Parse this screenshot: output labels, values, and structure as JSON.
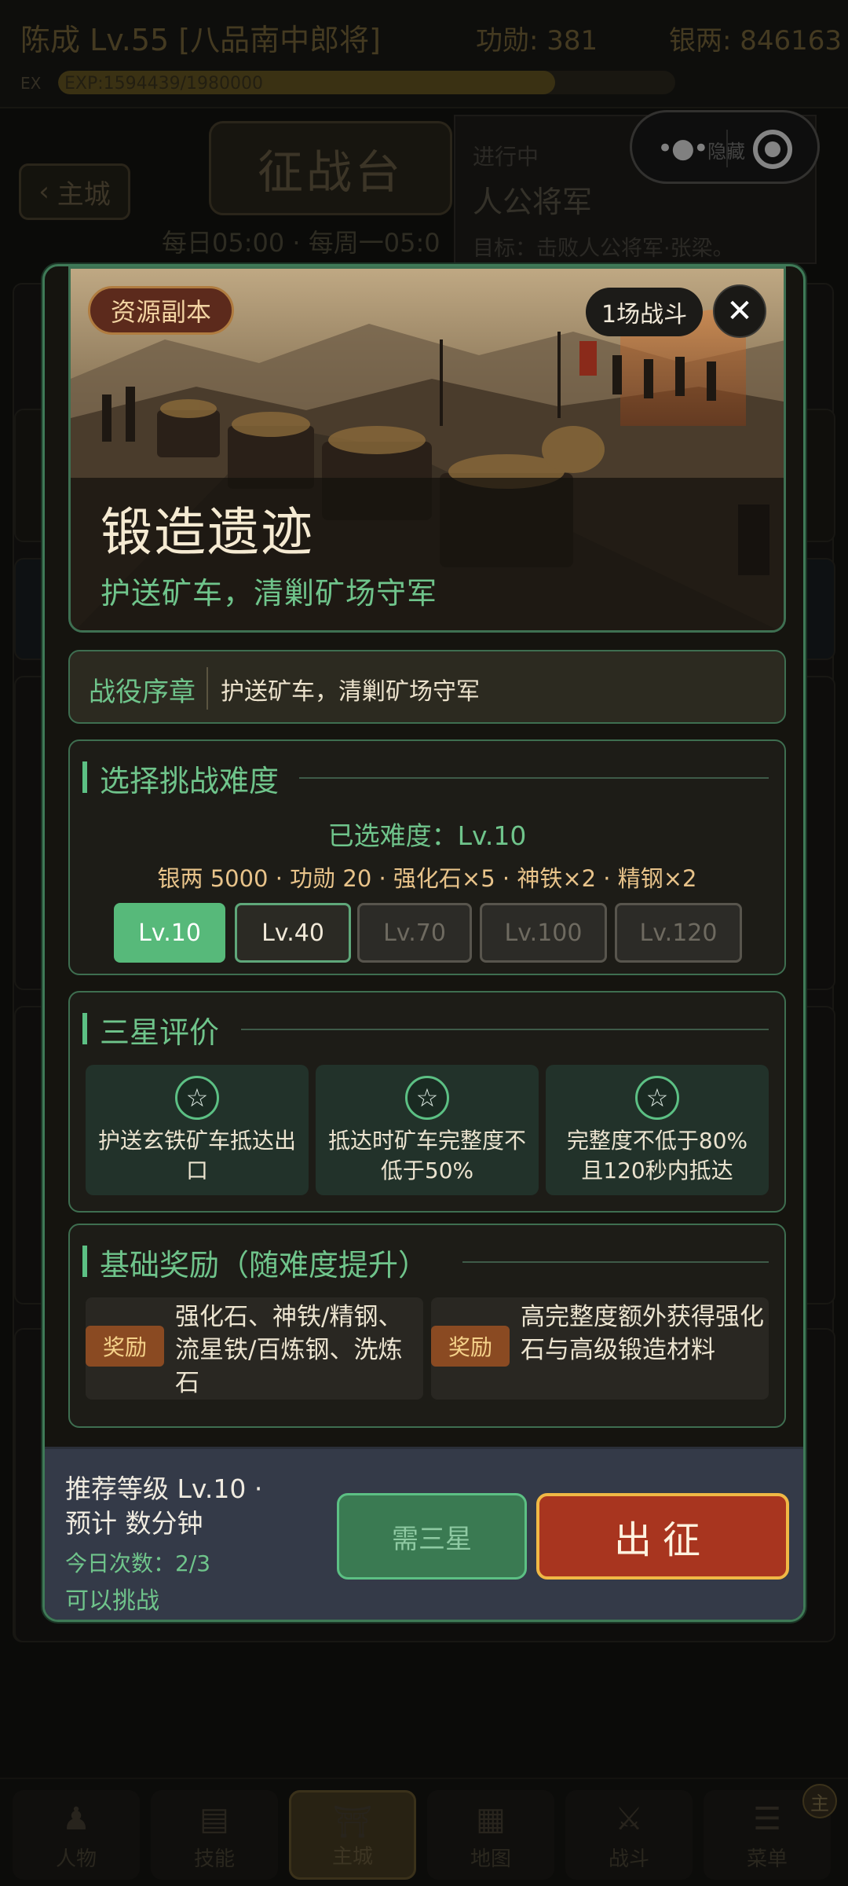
{
  "header": {
    "player": "陈成 Lv.55 [八品南中郎将]",
    "merit": "功勋: 381",
    "silver": "银两: 846163",
    "exp_label": "EX",
    "exp_text": "EXP:1594439/1980000",
    "exp_progress": 0.805
  },
  "page": {
    "back_label": "主城",
    "title": "征战台",
    "schedule": "每日05:00 · 每周一05:0"
  },
  "quest": {
    "status": "进行中",
    "name": "人公将军",
    "goal": "目标：击败人公将军·张梁。"
  },
  "capsule": {
    "hide_label": "隐藏"
  },
  "modal": {
    "tag": "资源副本",
    "battles": "1场战斗",
    "close": "✕",
    "title": "锻造遗迹",
    "subtitle": "护送矿车，清剿矿场守军",
    "prologue_label": "战役序章",
    "prologue_text": "护送矿车，清剿矿场守军",
    "difficulty": {
      "title": "选择挑战难度",
      "selected": "已选难度：Lv.10",
      "cost": "银两 5000 · 功勋 20 · 强化石×5 · 神铁×2 · 精钢×2",
      "levels": [
        {
          "label": "Lv.10",
          "state": "active"
        },
        {
          "label": "Lv.40",
          "state": "normal"
        },
        {
          "label": "Lv.70",
          "state": "locked"
        },
        {
          "label": "Lv.100",
          "state": "locked"
        },
        {
          "label": "Lv.120",
          "state": "locked"
        }
      ]
    },
    "stars": {
      "title": "三星评价",
      "icon": "☆",
      "items": [
        "护送玄铁矿车抵达出口",
        "抵达时矿车完整度不低于50%",
        "完整度不低于80%且120秒内抵达"
      ]
    },
    "rewards": {
      "title": "基础奖励（随难度提升）",
      "tag": "奖励",
      "items": [
        "强化石、神铁/精钢、流星铁/百炼钢、洗炼石",
        "高完整度额外获得强化石与高级锻造材料"
      ]
    },
    "footer": {
      "line1": "推荐等级  Lv.10  ·",
      "line2": "预计 数分钟",
      "count": "今日次数：2/3",
      "can": "可以挑战",
      "need_star": "需三星",
      "go": "出征"
    }
  },
  "nav": {
    "items": [
      "人物",
      "技能",
      "主城",
      "地图",
      "战斗",
      "菜单"
    ],
    "badge": "主"
  },
  "colors": {
    "accent_green": "#5cc084",
    "go_red": "#a8351f",
    "gold_border": "#f0b845",
    "footer_bg": "#343a48"
  }
}
